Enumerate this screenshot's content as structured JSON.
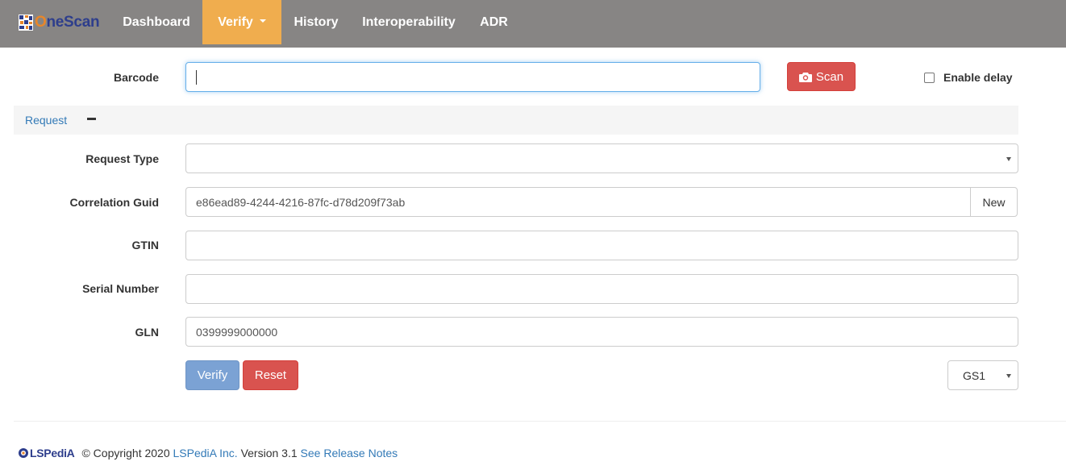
{
  "brand": {
    "name_first": "O",
    "name_rest": "neScan"
  },
  "nav": {
    "items": [
      "Dashboard",
      "Verify",
      "History",
      "Interoperability",
      "ADR"
    ],
    "active": "Verify"
  },
  "barcode": {
    "label": "Barcode",
    "value": ""
  },
  "scan_button": {
    "label": "Scan"
  },
  "enable_delay": {
    "label": "Enable delay",
    "checked": false
  },
  "request_panel": {
    "title": "Request"
  },
  "request_type": {
    "label": "Request Type",
    "value": ""
  },
  "correlation_guid": {
    "label": "Correlation Guid",
    "value": "e86ead89-4244-4216-87fc-d78d209f73ab",
    "new_label": "New"
  },
  "gtin": {
    "label": "GTIN",
    "value": ""
  },
  "serial_number": {
    "label": "Serial Number",
    "value": ""
  },
  "gln": {
    "label": "GLN",
    "value": "0399999000000"
  },
  "actions": {
    "verify_label": "Verify",
    "reset_label": "Reset",
    "format_value": "GS1"
  },
  "footer": {
    "logo_text": "LSPediA",
    "copyright": "© Copyright 2020",
    "company_link": "LSPediA Inc.",
    "version": "Version 3.1",
    "release_notes_link": "See Release Notes"
  },
  "colors": {
    "navbar": "#878584",
    "active_tab": "#f0ad4e",
    "danger": "#d9534f",
    "primary_disabled": "#7ba2d4",
    "link": "#337ab7"
  }
}
